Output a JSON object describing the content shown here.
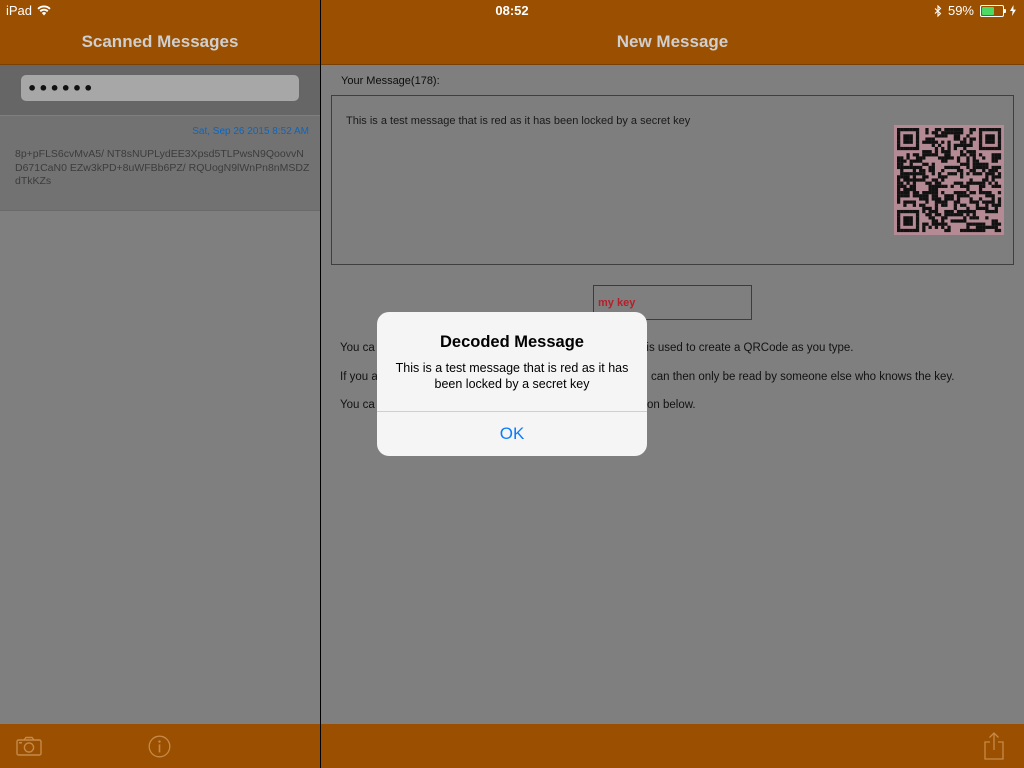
{
  "status_bar": {
    "device": "iPad",
    "time": "08:52",
    "battery": "59%",
    "battery_level": 0.59
  },
  "left_panel": {
    "title": "Scanned Messages",
    "search": {
      "value": "••••••"
    },
    "messages": [
      {
        "date": "Sat, Sep 26 2015 8:52 AM",
        "text": "8p+pFLS6cvMvA5/ NT8sNUPLydEE3Xpsd5TLPwsN9QoovvND671CaN0 EZw3kPD+8uWFBb6PZ/ RQUogN9lWnPn8nMSDZdTkKZs"
      }
    ],
    "toolbar": {
      "camera_icon": "camera-icon",
      "info_icon": "info-icon"
    }
  },
  "right_panel": {
    "title": "New Message",
    "message_label": "Your Message(178):",
    "message_text": "This is a test message that is red as it has been locked by a secret key",
    "key_input": {
      "value": "my key"
    },
    "help_lines": [
      {
        "left": "You ca",
        "right": "t is used to create a QRCode as you type."
      },
      {
        "left": "If you a",
        "right": "can then only be read by someone else who knows the key."
      },
      {
        "left": "You ca",
        "right": "on below."
      }
    ],
    "toolbar": {
      "share_icon": "share-icon"
    }
  },
  "alert": {
    "title": "Decoded Message",
    "message": "This is a test message that is red as it has been locked by a secret key",
    "ok_label": "OK"
  },
  "colors": {
    "accent": "#9A5000",
    "alert_button": "#0A7CFF",
    "key_text": "#B3202A",
    "date_text": "#0A66C2"
  }
}
